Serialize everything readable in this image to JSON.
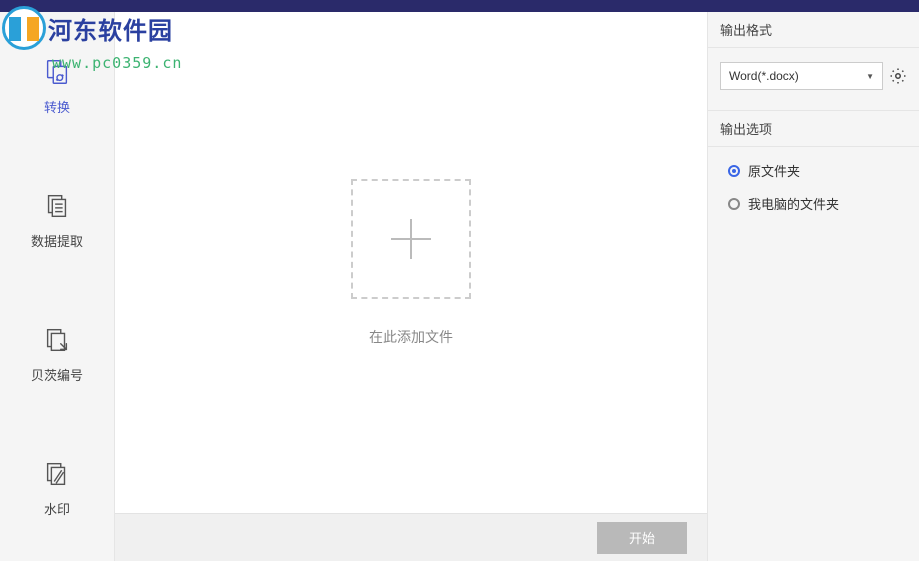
{
  "sidebar": {
    "items": [
      {
        "label": "转换"
      },
      {
        "label": "数据提取"
      },
      {
        "label": "贝茨编号"
      },
      {
        "label": "水印"
      }
    ]
  },
  "center": {
    "drop_text": "在此添加文件",
    "start_label": "开始"
  },
  "right": {
    "format_header": "输出格式",
    "format_selected": "Word(*.docx)",
    "options_header": "输出选项",
    "radios": [
      {
        "label": "原文件夹",
        "checked": true
      },
      {
        "label": "我电脑的文件夹",
        "checked": false
      }
    ]
  },
  "watermark": {
    "title": "河东软件园",
    "url": "www.pc0359.cn"
  }
}
